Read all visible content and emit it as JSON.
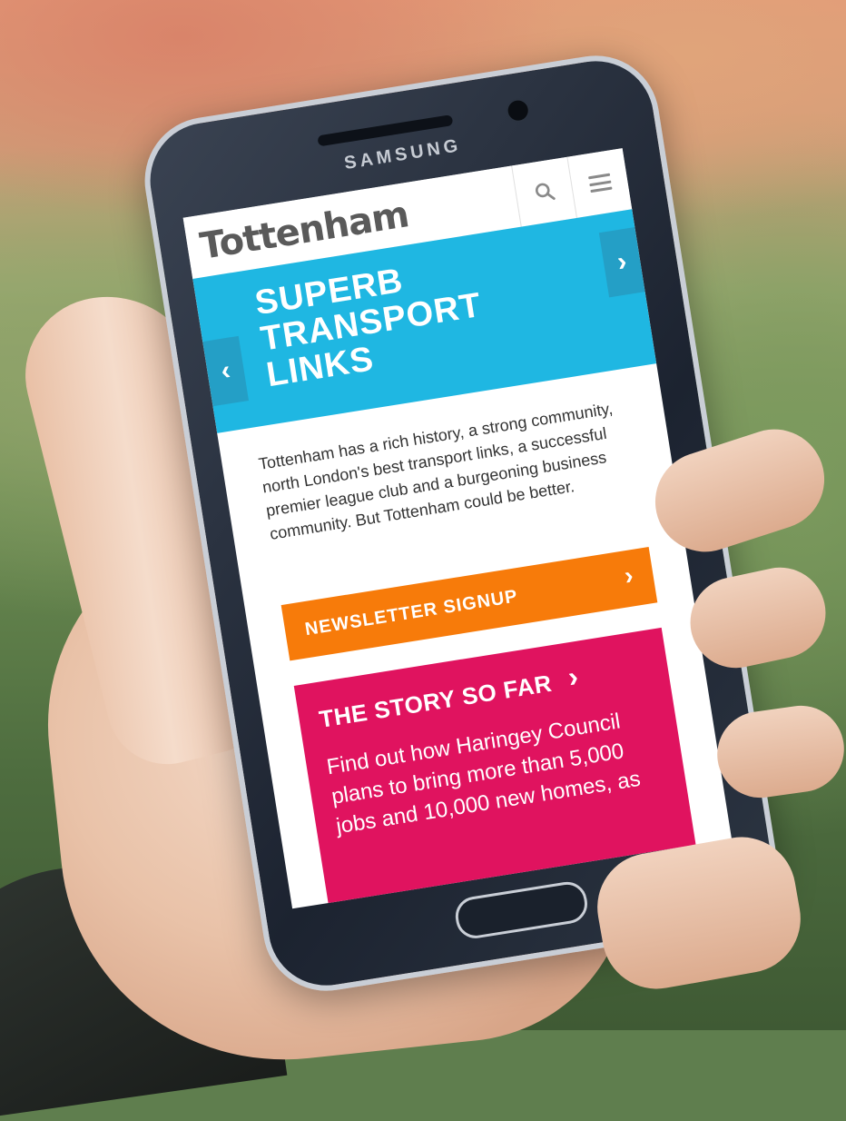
{
  "phone": {
    "brand": "SAMSUNG"
  },
  "site": {
    "logo": "Tottenham",
    "hero": {
      "title_lines": [
        "SUPERB",
        "TRANSPORT",
        "LINKS"
      ],
      "prev": "‹",
      "next": "›"
    },
    "intro": "Tottenham has a rich history, a strong community, north London's best transport links, a successful premier league club and a burgeoning business community. But Tottenham could be better.",
    "newsletter": {
      "label": "NEWSLETTER SIGNUP",
      "chevron": "›"
    },
    "story": {
      "title": "THE STORY SO FAR",
      "chevron": "›",
      "text": "Find out how Haringey Council plans to bring more than 5,000 jobs and 10,000 new homes, as"
    }
  },
  "colors": {
    "hero": "#1fb7e2",
    "newsletter": "#f77b0a",
    "story": "#e0135f",
    "logo": "#5a5a5a"
  },
  "icons": {
    "search": "search-icon",
    "menu": "hamburger-menu-icon"
  }
}
